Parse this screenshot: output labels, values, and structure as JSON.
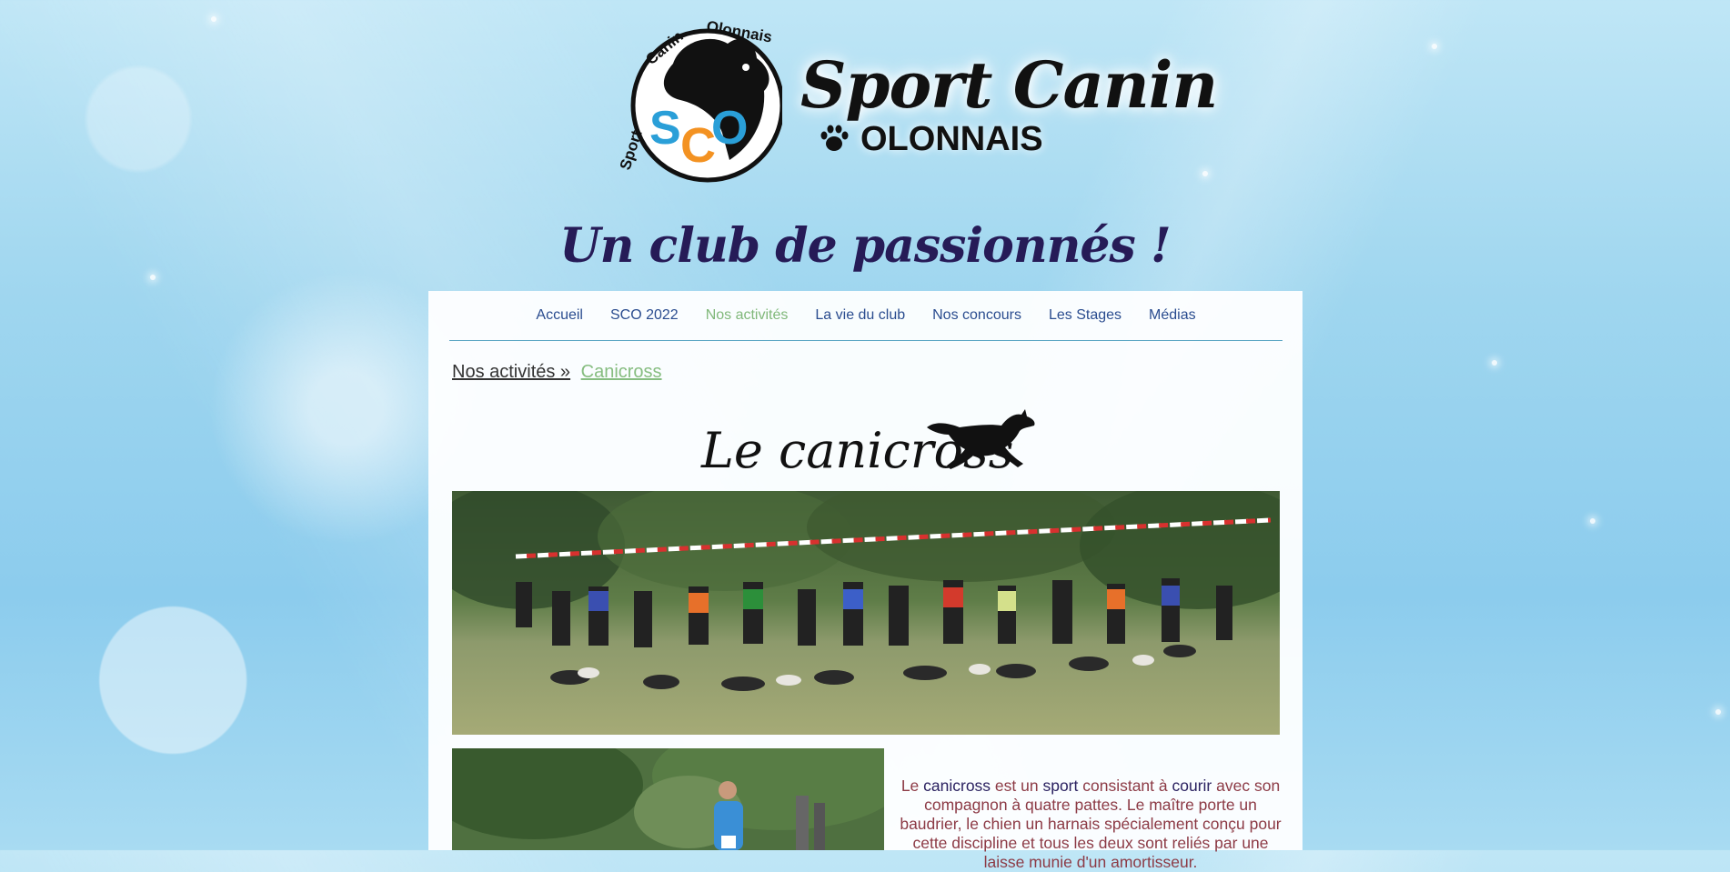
{
  "logo": {
    "emblem_text": "Sport Canin Olonnais",
    "emblem_initials": "SCO",
    "brand_name": "Sport Canin",
    "brand_sub": "OLONNAIS"
  },
  "tagline": "Un club de passionnés !",
  "nav": {
    "items": [
      {
        "label": "Accueil"
      },
      {
        "label": "SCO 2022"
      },
      {
        "label": "Nos activités",
        "active": true
      },
      {
        "label": "La vie du club"
      },
      {
        "label": "Nos concours"
      },
      {
        "label": "Les Stages"
      },
      {
        "label": "Médias"
      }
    ]
  },
  "breadcrumb": {
    "parent": "Nos activités »",
    "current": "Canicross"
  },
  "page_title": "Le canicross",
  "intro": {
    "w1": "Le ",
    "k1": "canicross",
    "w2": " est un ",
    "k2": "sport",
    "w3": " consistant à ",
    "k3": "courir",
    "w4": " avec son compagnon à quatre pattes. Le maître porte un baudrier, le chien un harnais spécialement conçu pour cette discipline et tous les deux sont reliés par une laisse munie d'un amortisseur."
  },
  "colors": {
    "nav_link": "#2a4c8f",
    "nav_active": "#80b87a",
    "tagline": "#261b57",
    "intro_text": "#8c3a45",
    "intro_keyword": "#2a2160"
  }
}
